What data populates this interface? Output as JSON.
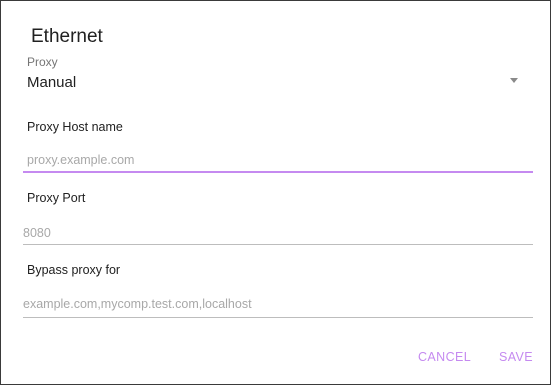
{
  "dialog": {
    "title": "Ethernet",
    "proxy": {
      "label": "Proxy",
      "selected": "Manual"
    },
    "host": {
      "label": "Proxy Host name",
      "placeholder": "proxy.example.com"
    },
    "port": {
      "label": "Proxy Port",
      "placeholder": "8080"
    },
    "bypass": {
      "label": "Bypass proxy for",
      "placeholder": "example.com,mycomp.test.com,localhost"
    },
    "actions": {
      "cancel": "CANCEL",
      "save": "SAVE"
    }
  },
  "colors": {
    "accent": "#c58af0",
    "divider": "#bdbdbd",
    "hint": "#a8a8a8"
  },
  "icons": {
    "dropdown": "chevron-down-icon"
  }
}
